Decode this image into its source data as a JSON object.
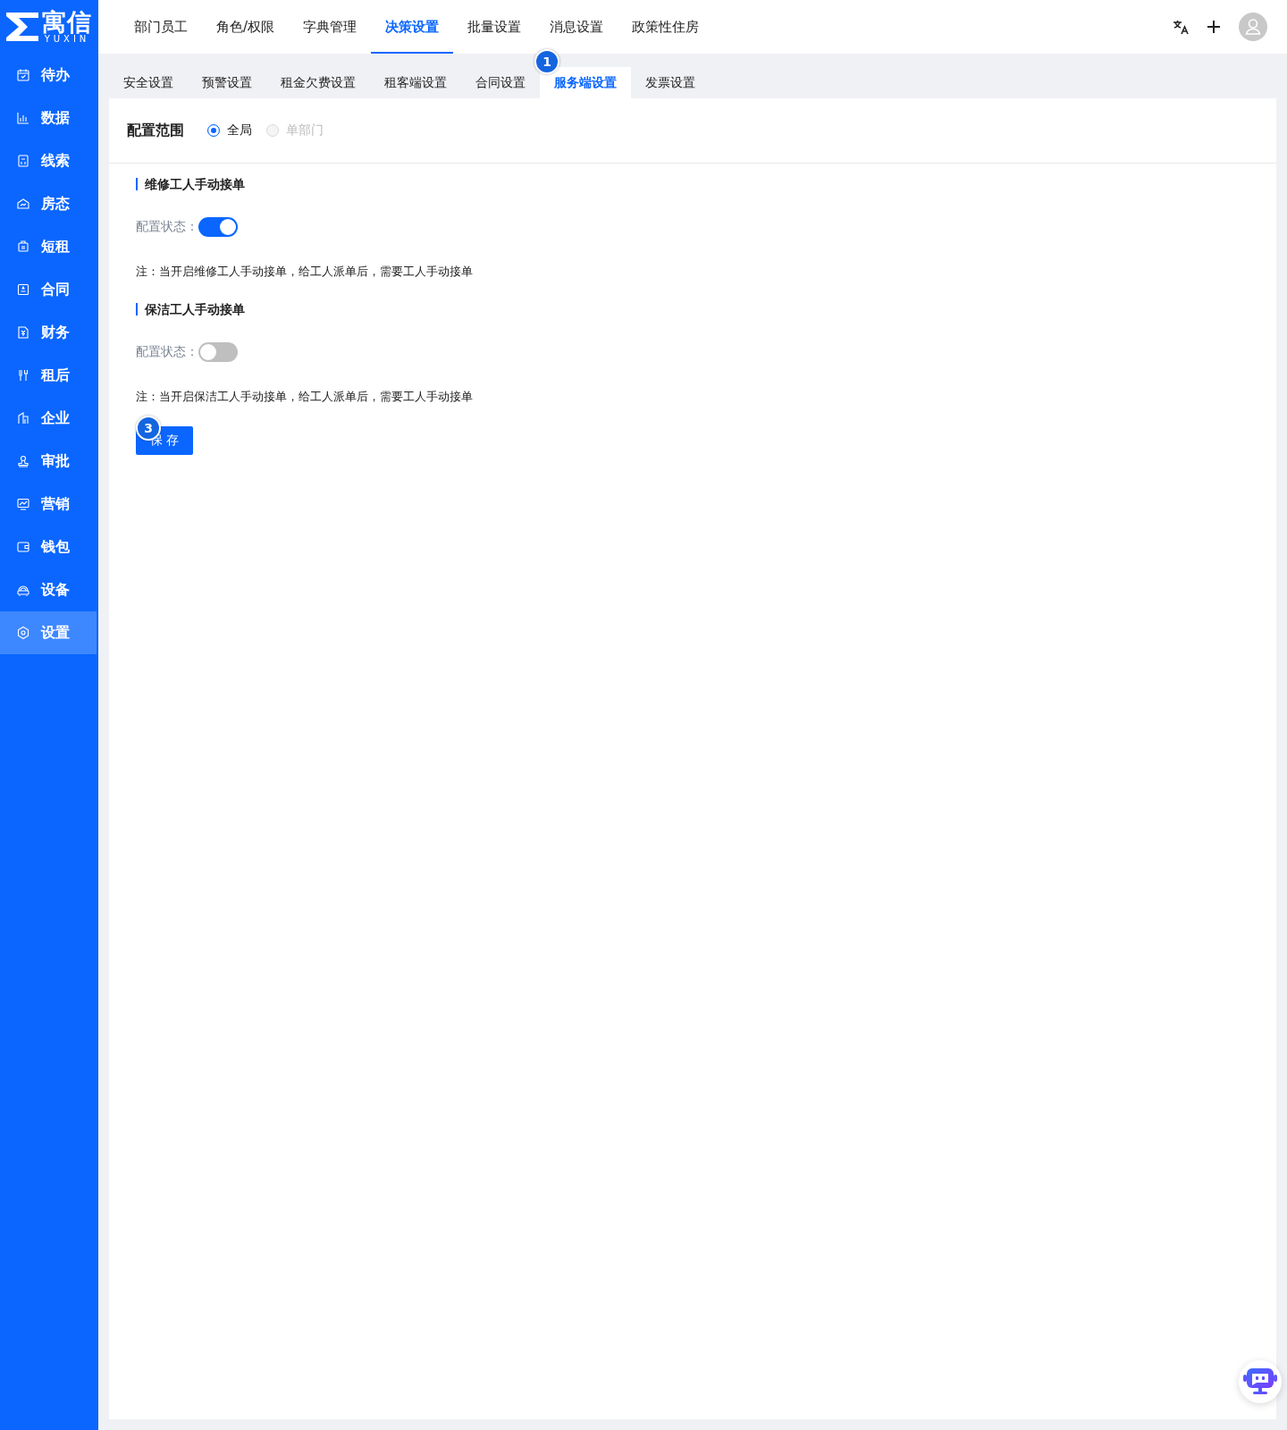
{
  "logo": {
    "name": "寓信",
    "subtitle": "YUXIN"
  },
  "top_nav": [
    {
      "label": "部门员工",
      "selected": false
    },
    {
      "label": "角色/权限",
      "selected": false
    },
    {
      "label": "字典管理",
      "selected": false
    },
    {
      "label": "决策设置",
      "selected": true
    },
    {
      "label": "批量设置",
      "selected": false
    },
    {
      "label": "消息设置",
      "selected": false
    },
    {
      "label": "政策性住房",
      "selected": false
    }
  ],
  "sidebar": [
    {
      "label": "待办",
      "selected": false
    },
    {
      "label": "数据",
      "selected": false
    },
    {
      "label": "线索",
      "selected": false
    },
    {
      "label": "房态",
      "selected": false
    },
    {
      "label": "短租",
      "selected": false
    },
    {
      "label": "合同",
      "selected": false
    },
    {
      "label": "财务",
      "selected": false
    },
    {
      "label": "租后",
      "selected": false
    },
    {
      "label": "企业",
      "selected": false
    },
    {
      "label": "审批",
      "selected": false
    },
    {
      "label": "营销",
      "selected": false
    },
    {
      "label": "钱包",
      "selected": false
    },
    {
      "label": "设备",
      "selected": false
    },
    {
      "label": "设置",
      "selected": true
    }
  ],
  "sub_tabs": [
    {
      "label": "安全设置",
      "selected": false
    },
    {
      "label": "预警设置",
      "selected": false
    },
    {
      "label": "租金欠费设置",
      "selected": false
    },
    {
      "label": "租客端设置",
      "selected": false
    },
    {
      "label": "合同设置",
      "selected": false
    },
    {
      "label": "服务端设置",
      "selected": true,
      "badge": "1"
    },
    {
      "label": "发票设置",
      "selected": false
    }
  ],
  "scope": {
    "label": "配置范围",
    "options": [
      {
        "label": "全局",
        "selected": true,
        "disabled": false
      },
      {
        "label": "单部门",
        "selected": false,
        "disabled": true
      }
    ]
  },
  "sections": [
    {
      "title": "维修工人手动接单",
      "status_label": "配置状态：",
      "on": true,
      "note": "注：当开启维修工人手动接单，给工人派单后，需要工人手动接单"
    },
    {
      "title": "保洁工人手动接单",
      "status_label": "配置状态：",
      "on": false,
      "note": "注：当开启保洁工人手动接单，给工人派单后，需要工人手动接单"
    }
  ],
  "save_button": {
    "label": "保 存",
    "badge": "3"
  }
}
